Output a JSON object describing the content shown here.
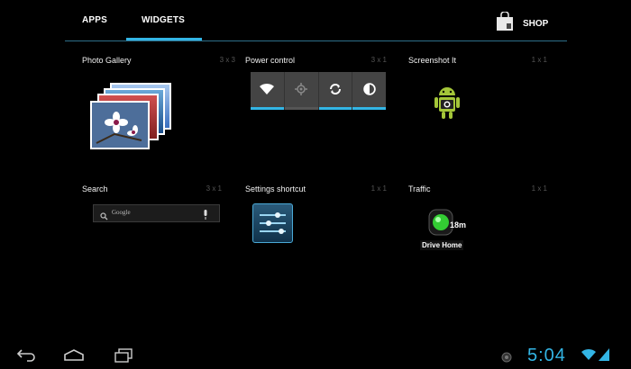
{
  "tabs": {
    "apps": "APPS",
    "widgets": "WIDGETS"
  },
  "shop": {
    "label": "SHOP",
    "icon": "shopping-bag-icon"
  },
  "widgets": [
    {
      "name": "Photo Gallery",
      "dims": "3 x 3"
    },
    {
      "name": "Power control",
      "dims": "3 x 1"
    },
    {
      "name": "Screenshot It",
      "dims": "1 x 1"
    },
    {
      "name": "Search",
      "dims": "3 x 1"
    },
    {
      "name": "Settings shortcut",
      "dims": "1 x 1"
    },
    {
      "name": "Traffic",
      "dims": "1 x 1"
    }
  ],
  "search_widget": {
    "placeholder": "Google"
  },
  "traffic_widget": {
    "time": "18m",
    "label": "Drive Home"
  },
  "status": {
    "time": "5:04"
  },
  "colors": {
    "accent": "#33b5e5",
    "background": "#000000"
  }
}
